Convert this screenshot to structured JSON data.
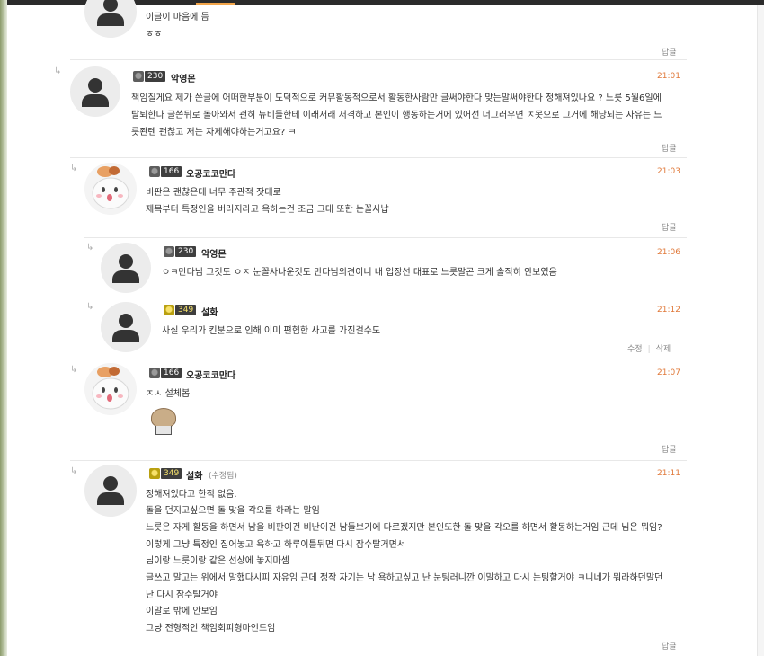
{
  "comments": [
    {
      "nick": "",
      "level": "",
      "time": "",
      "lines": [
        "이글이 마음에 듬",
        "ㅎㅎ"
      ],
      "reply_label": "답글"
    },
    {
      "nick": "악영몬",
      "level": "230",
      "time": "21:01",
      "lines": [
        "책임질게요 제가 쓴글에 어떠한부분이 도덕적으로 커뮤활동적으로서 활동한사람만 글써야한다 맞는말써야한다 정해져있나요 ? 느릇 5월6일에",
        "탈퇴한다 글쓴뒤로 돌아와서 괜히 뉴비들한테 이래저래 저격하고 본인이 행동하는거에 있어선 너그러우면 ㅈ못으로 그거에 해당되는 자유는 느",
        "릇좐텐 괜찮고 저는 자제해야하는거고요? ㅋ"
      ],
      "reply_label": "답글"
    },
    {
      "nick": "오공코코만다",
      "level": "166",
      "time": "21:03",
      "lines": [
        "비판은 괜찮은데 너무 주관적 잣대로",
        "제목부터 특정인을 버러지라고 욕하는건 조금 그대 또한 눈꼴사납"
      ],
      "reply_label": "답글"
    },
    {
      "nick": "악영몬",
      "level": "230",
      "time": "21:06",
      "lines": [
        "ㅇㅋ만다님 그것도 ㅇㅈ 눈꼴사나운것도 만다님의견이니 내 입장선 대표로 느릇말곤 크게 솔직히 안보였음"
      ]
    },
    {
      "nick": "설화",
      "level": "349",
      "time": "21:12",
      "lines": [
        "사실 우리가 킨분으로 인해 이미 편협한 사고를 가진걸수도"
      ],
      "edit_label": "수정",
      "delete_label": "삭제"
    },
    {
      "nick": "오공코코만다",
      "level": "166",
      "time": "21:07",
      "lines": [
        "ㅈㅅ 설체봄"
      ],
      "sticker": "helmet-sticker",
      "reply_label": "답글"
    },
    {
      "nick": "설화",
      "level": "349",
      "edited": "(수정됨)",
      "time": "21:11",
      "lines": [
        "정해져있다고 한적 없음.",
        "돌을 던지고싶으면 돌 맞을 각오를 하라는 말임",
        "느릇은 자게 활동을 하면서 남을 비판이건 비난이건 남들보기에 다르겠지만 본인또한 돌 맞을 각오를 하면서 활동하는거임 근데 님은 뭐임?",
        "이렇게 그냥 특정인 집어놓고 욕하고 하루이틀뒤면 다시 잠수탈거면서",
        "님이랑 느릇이랑 같은 선상에 놓지마셈",
        "글쓰고 말고는 위에서 말했다시피 자유임 근데 정작 자기는 남 욕하고싶고 난 눈팅러니깐 이말하고 다시 눈팅할거야 ㅋ니네가 뭐라하던말던",
        "난 다시 잠수탈거야",
        "이말로 밖에 안보임",
        "그냥 전형적인 책임회피형마인드임"
      ],
      "reply_label": "답글"
    }
  ],
  "colors": {
    "time": "#e0793a",
    "divider": "#e8e8e8",
    "level_badge": "#3e3e3e"
  }
}
